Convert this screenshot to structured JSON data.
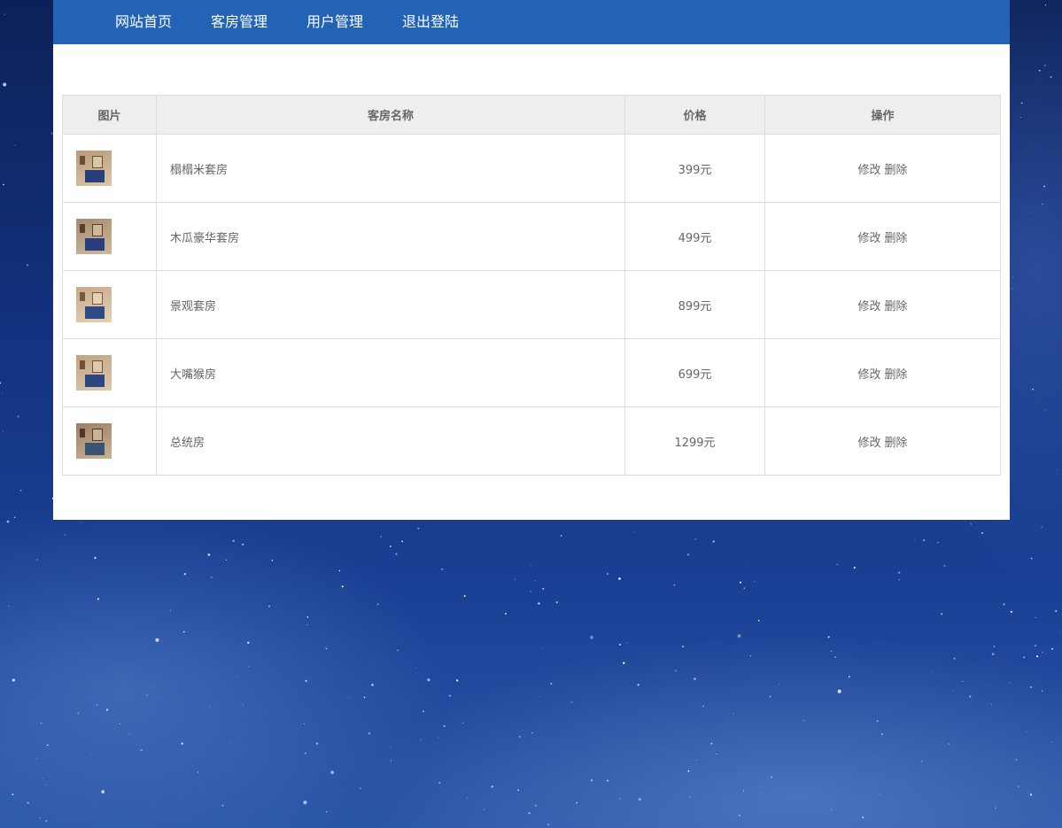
{
  "nav": {
    "items": [
      "网站首页",
      "客房管理",
      "用户管理",
      "退出登陆"
    ]
  },
  "table": {
    "headers": [
      "图片",
      "客房名称",
      "价格",
      "操作"
    ],
    "rows": [
      {
        "name": "榻榻米套房",
        "price": "399元",
        "edit": "修改",
        "delete": "删除"
      },
      {
        "name": "木瓜豪华套房",
        "price": "499元",
        "edit": "修改",
        "delete": "删除"
      },
      {
        "name": "景观套房",
        "price": "899元",
        "edit": "修改",
        "delete": "删除"
      },
      {
        "name": "大嘴猴房",
        "price": "699元",
        "edit": "修改",
        "delete": "删除"
      },
      {
        "name": "总统房",
        "price": "1299元",
        "edit": "修改",
        "delete": "删除"
      }
    ]
  },
  "colors": {
    "nav_bg": "#2263b5",
    "header_bg": "#eeeeee",
    "text": "#666666",
    "border": "#dddddd"
  }
}
